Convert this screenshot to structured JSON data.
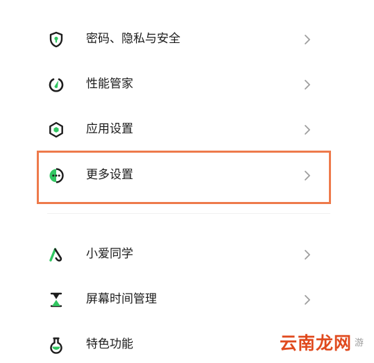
{
  "settings": {
    "items": [
      {
        "label": "密码、隐私与安全",
        "icon": "shield-icon"
      },
      {
        "label": "性能管家",
        "icon": "performance-gauge-icon"
      },
      {
        "label": "应用设置",
        "icon": "hexagon-app-icon"
      },
      {
        "label": "更多设置",
        "icon": "more-dots-icon"
      },
      {
        "label": "小爱同学",
        "icon": "xiaoai-assistant-icon"
      },
      {
        "label": "屏幕时间管理",
        "icon": "hourglass-icon"
      },
      {
        "label": "特色功能",
        "icon": "flask-icon"
      }
    ]
  },
  "watermark": {
    "text": "云南龙网",
    "suffix": "游"
  },
  "colors": {
    "accent_green": "#31c661",
    "icon_dark": "#1c1c1c",
    "highlight_border": "#ee7a4b",
    "chevron": "#9e9e9e"
  }
}
